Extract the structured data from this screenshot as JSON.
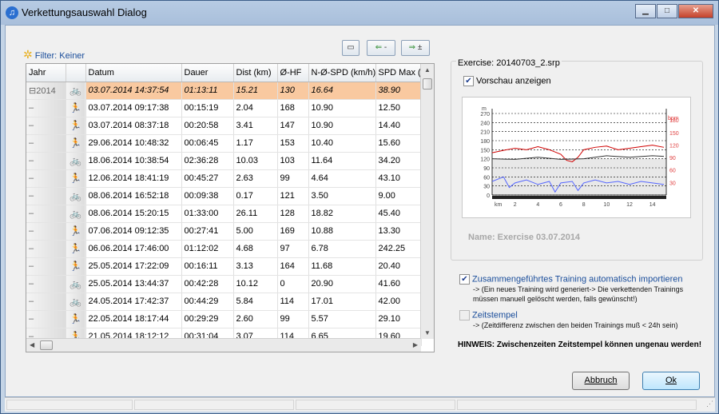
{
  "window": {
    "title": "Verkettungsauswahl Dialog"
  },
  "filter": {
    "label": "Filter: Keiner"
  },
  "toolbar": {
    "btn2_label": "-",
    "btn3_label": "±"
  },
  "grid": {
    "columns": [
      "Jahr",
      "",
      "Datum",
      "Dauer",
      "Dist (km)",
      "Ø-HF",
      "N-Ø-SPD (km/h)",
      "SPD Max ("
    ],
    "rows": [
      {
        "jahr": "⊟2014",
        "sport": "bike",
        "datum": "03.07.2014 14:37:54",
        "dauer": "01:13:11",
        "dist": "15.21",
        "hf": "130",
        "spd": "16.64",
        "max": "38.90",
        "selected": true
      },
      {
        "jahr": "–",
        "sport": "run",
        "datum": "03.07.2014 09:17:38",
        "dauer": "00:15:19",
        "dist": "2.04",
        "hf": "168",
        "spd": "10.90",
        "max": "12.50"
      },
      {
        "jahr": "–",
        "sport": "run",
        "datum": "03.07.2014 08:37:18",
        "dauer": "00:20:58",
        "dist": "3.41",
        "hf": "147",
        "spd": "10.90",
        "max": "14.40"
      },
      {
        "jahr": "–",
        "sport": "run",
        "datum": "29.06.2014 10:48:32",
        "dauer": "00:06:45",
        "dist": "1.17",
        "hf": "153",
        "spd": "10.40",
        "max": "15.60"
      },
      {
        "jahr": "–",
        "sport": "bike",
        "datum": "18.06.2014 10:38:54",
        "dauer": "02:36:28",
        "dist": "10.03",
        "hf": "103",
        "spd": "11.64",
        "max": "34.20"
      },
      {
        "jahr": "–",
        "sport": "run",
        "datum": "12.06.2014 18:41:19",
        "dauer": "00:45:27",
        "dist": "2.63",
        "hf": "99",
        "spd": "4.64",
        "max": "43.10"
      },
      {
        "jahr": "–",
        "sport": "bike",
        "datum": "08.06.2014 16:52:18",
        "dauer": "00:09:38",
        "dist": "0.17",
        "hf": "121",
        "spd": "3.50",
        "max": "9.00"
      },
      {
        "jahr": "–",
        "sport": "bike",
        "datum": "08.06.2014 15:20:15",
        "dauer": "01:33:00",
        "dist": "26.11",
        "hf": "128",
        "spd": "18.82",
        "max": "45.40"
      },
      {
        "jahr": "–",
        "sport": "run",
        "datum": "07.06.2014 09:12:35",
        "dauer": "00:27:41",
        "dist": "5.00",
        "hf": "169",
        "spd": "10.88",
        "max": "13.30"
      },
      {
        "jahr": "–",
        "sport": "run",
        "datum": "06.06.2014 17:46:00",
        "dauer": "01:12:02",
        "dist": "4.68",
        "hf": "97",
        "spd": "6.78",
        "max": "242.25"
      },
      {
        "jahr": "–",
        "sport": "run",
        "datum": "25.05.2014 17:22:09",
        "dauer": "00:16:11",
        "dist": "3.13",
        "hf": "164",
        "spd": "11.68",
        "max": "20.40"
      },
      {
        "jahr": "–",
        "sport": "bike",
        "datum": "25.05.2014 13:44:37",
        "dauer": "00:42:28",
        "dist": "10.12",
        "hf": "0",
        "spd": "20.90",
        "max": "41.60"
      },
      {
        "jahr": "–",
        "sport": "bike",
        "datum": "24.05.2014 17:42:37",
        "dauer": "00:44:29",
        "dist": "5.84",
        "hf": "114",
        "spd": "17.01",
        "max": "42.00"
      },
      {
        "jahr": "–",
        "sport": "run",
        "datum": "22.05.2014 18:17:44",
        "dauer": "00:29:29",
        "dist": "2.60",
        "hf": "99",
        "spd": "5.57",
        "max": "29.10"
      },
      {
        "jahr": "–",
        "sport": "run",
        "datum": "21.05.2014 18:12:12",
        "dauer": "00:31:04",
        "dist": "3.07",
        "hf": "114",
        "spd": "6.65",
        "max": "19.60"
      }
    ]
  },
  "preview": {
    "exercise_label": "Exercise: 20140703_2.srp",
    "show_preview_label": "Vorschau anzeigen",
    "show_preview_checked": true,
    "name_label": "Name: Exercise 03.07.2014"
  },
  "chart_data": {
    "type": "line",
    "left_unit": "m",
    "right_unit": "bpm",
    "x_unit": "km",
    "left_ticks": [
      "270",
      "240",
      "210",
      "180",
      "150",
      "120",
      "90",
      "60",
      "30",
      "0"
    ],
    "right_ticks": [
      "180",
      "150",
      "120",
      "90",
      "60",
      "30"
    ],
    "x_ticks": [
      "2",
      "4",
      "6",
      "8",
      "10",
      "12",
      "14"
    ],
    "xlim": [
      0,
      15.21
    ],
    "series": [
      {
        "name": "hr",
        "color": "#d00000",
        "x": [
          0,
          1,
          2,
          3,
          4,
          5,
          6,
          6.5,
          7,
          7.5,
          8,
          9,
          10,
          11,
          12,
          13,
          14,
          15
        ],
        "y": [
          140,
          148,
          155,
          150,
          160,
          150,
          135,
          115,
          110,
          125,
          150,
          158,
          162,
          150,
          155,
          160,
          165,
          158
        ]
      },
      {
        "name": "alt",
        "color": "#333333",
        "x": [
          0,
          2,
          4,
          6,
          8,
          10,
          12,
          14,
          15
        ],
        "y": [
          120,
          118,
          125,
          118,
          120,
          130,
          125,
          130,
          128
        ]
      },
      {
        "name": "spd",
        "color": "#5566ff",
        "x": [
          0,
          1,
          1.5,
          2,
          3,
          4,
          5,
          5.5,
          6,
          7,
          7.5,
          8,
          9,
          10,
          11,
          12,
          13,
          14,
          15
        ],
        "y": [
          45,
          60,
          25,
          40,
          50,
          35,
          45,
          10,
          40,
          45,
          15,
          40,
          50,
          40,
          45,
          35,
          45,
          40,
          35
        ]
      }
    ]
  },
  "options": {
    "import_label": "Zusammengeführtes Training automatisch importieren",
    "import_checked": true,
    "import_note": "-> (Ein neues Training wird generiert-> Die verkettenden Trainings müssen manuell gelöscht werden, falls gewünscht!)",
    "timestamp_label": "Zeitstempel",
    "timestamp_checked": false,
    "timestamp_note": "-> (Zeitdifferenz zwischen den beiden Trainings muß < 24h sein)",
    "hint": "HINWEIS: Zwischenzeiten Zeitstempel können ungenau werden!"
  },
  "buttons": {
    "cancel": "Abbruch",
    "ok": "Ok"
  },
  "colors": {
    "selected_row": "#f9c9a0",
    "link": "#1b4e9b"
  }
}
